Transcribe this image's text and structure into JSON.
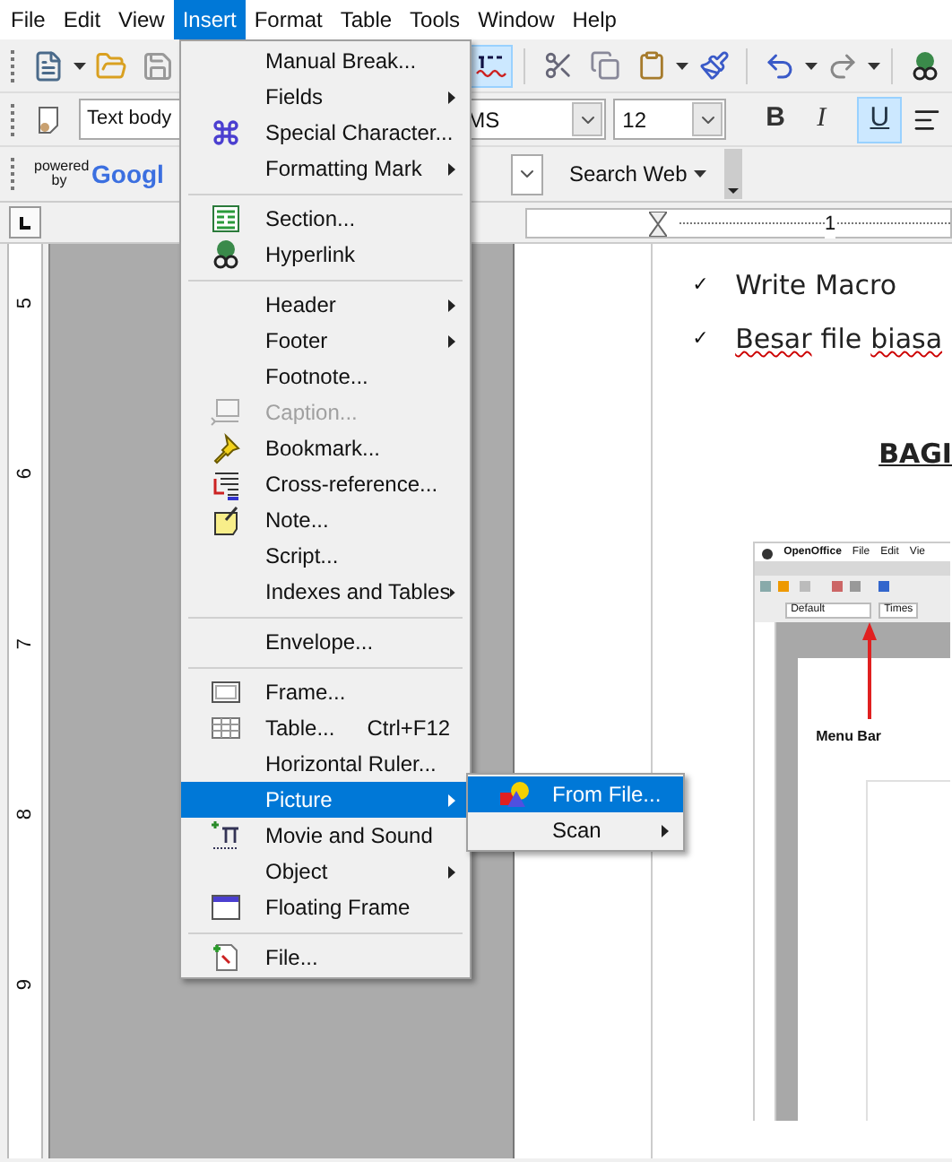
{
  "menubar": [
    {
      "label": "File",
      "selected": false
    },
    {
      "label": "Edit",
      "selected": false
    },
    {
      "label": "View",
      "selected": false
    },
    {
      "label": "Insert",
      "selected": true
    },
    {
      "label": "Format",
      "selected": false
    },
    {
      "label": "Table",
      "selected": false
    },
    {
      "label": "Tools",
      "selected": false
    },
    {
      "label": "Window",
      "selected": false
    },
    {
      "label": "Help",
      "selected": false
    }
  ],
  "standard_toolbar": {
    "auto_spellcheck": true
  },
  "formatting_toolbar": {
    "paragraph_style": "Text body",
    "font_name": "MS",
    "font_size": "12",
    "bold_label": "B",
    "italic_label": "I",
    "underline_label": "U",
    "bold": false,
    "italic": false,
    "underline": true
  },
  "search_toolbar": {
    "powered_by": "powered by",
    "logo": "Googl",
    "search_button": "Search Web"
  },
  "vertical_ruler": {
    "labels": [
      "5",
      "6",
      "7",
      "8",
      "9"
    ]
  },
  "horizontal_ruler": {
    "labels": [
      "1"
    ]
  },
  "document": {
    "bullets": [
      {
        "mark": "✓",
        "words": [
          {
            "word": "Write",
            "misspelled": false
          },
          {
            "word": "Macro",
            "misspelled": false
          }
        ]
      },
      {
        "mark": "✓",
        "words": [
          {
            "word": "Besar",
            "misspelled": true
          },
          {
            "word": "file",
            "misspelled": false
          },
          {
            "word": "biasa",
            "misspelled": true
          }
        ]
      }
    ],
    "heading": "BAGI",
    "screenshot": {
      "menu_bar": [
        "OpenOffice",
        "File",
        "Edit",
        "Vie"
      ],
      "style_box": "Default",
      "font_box": "Times",
      "callout": "Menu Bar"
    }
  },
  "insert_menu": {
    "groups": [
      [
        {
          "label": "Manual Break...",
          "submenu": false,
          "disabled": false,
          "selected": false
        },
        {
          "label": "Fields",
          "submenu": true,
          "disabled": false,
          "selected": false
        },
        {
          "label": "Special Character...",
          "submenu": false,
          "disabled": false,
          "selected": false
        },
        {
          "label": "Formatting Mark",
          "submenu": true,
          "disabled": false,
          "selected": false
        }
      ],
      [
        {
          "label": "Section...",
          "submenu": false,
          "disabled": false,
          "selected": false
        },
        {
          "label": "Hyperlink",
          "submenu": false,
          "disabled": false,
          "selected": false
        }
      ],
      [
        {
          "label": "Header",
          "submenu": true,
          "disabled": false,
          "selected": false
        },
        {
          "label": "Footer",
          "submenu": true,
          "disabled": false,
          "selected": false
        },
        {
          "label": "Footnote...",
          "submenu": false,
          "disabled": false,
          "selected": false
        },
        {
          "label": "Caption...",
          "submenu": false,
          "disabled": true,
          "selected": false
        },
        {
          "label": "Bookmark...",
          "submenu": false,
          "disabled": false,
          "selected": false
        },
        {
          "label": "Cross-reference...",
          "submenu": false,
          "disabled": false,
          "selected": false
        },
        {
          "label": "Note...",
          "submenu": false,
          "disabled": false,
          "selected": false
        },
        {
          "label": "Script...",
          "submenu": false,
          "disabled": false,
          "selected": false
        },
        {
          "label": "Indexes and Tables",
          "submenu": true,
          "disabled": false,
          "selected": false
        }
      ],
      [
        {
          "label": "Envelope...",
          "submenu": false,
          "disabled": false,
          "selected": false
        }
      ],
      [
        {
          "label": "Frame...",
          "submenu": false,
          "disabled": false,
          "selected": false
        },
        {
          "label": "Table...",
          "shortcut": "Ctrl+F12",
          "submenu": false,
          "disabled": false,
          "selected": false
        },
        {
          "label": "Horizontal Ruler...",
          "submenu": false,
          "disabled": false,
          "selected": false
        },
        {
          "label": "Picture",
          "submenu": true,
          "disabled": false,
          "selected": true
        },
        {
          "label": "Movie and Sound",
          "submenu": false,
          "disabled": false,
          "selected": false
        },
        {
          "label": "Object",
          "submenu": true,
          "disabled": false,
          "selected": false
        },
        {
          "label": "Floating Frame",
          "submenu": false,
          "disabled": false,
          "selected": false
        }
      ],
      [
        {
          "label": "File...",
          "submenu": false,
          "disabled": false,
          "selected": false
        }
      ]
    ]
  },
  "picture_submenu": [
    {
      "label": "From File...",
      "submenu": false,
      "selected": true
    },
    {
      "label": "Scan",
      "submenu": true,
      "selected": false
    }
  ]
}
